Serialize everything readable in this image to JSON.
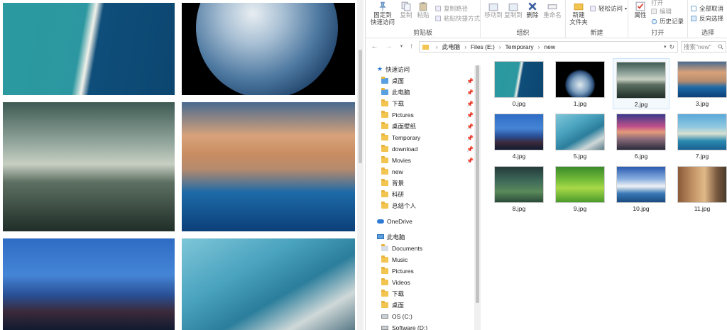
{
  "ribbon": {
    "pin_label": "固定到\n快速访问",
    "copy_label": "复制",
    "paste_label": "粘贴",
    "copy_path_label": "复制路径",
    "paste_shortcut_label": "粘贴快捷方式",
    "clipboard_group": "剪贴板",
    "move_to_label": "移动到",
    "copy_to_label": "复制到",
    "delete_label": "删除",
    "rename_label": "重命名",
    "organize_group": "组织",
    "new_folder_label": "新建\n文件夹",
    "easy_access_label": "轻松访问",
    "new_group": "新建",
    "properties_label": "属性",
    "open_label": "打开",
    "edit_label": "编辑",
    "history_label": "历史记录",
    "open_group": "打开",
    "select_all_label": "全部取消",
    "invert_label": "反向选择",
    "select_group": "选择"
  },
  "address": {
    "crumbs": [
      "此电脑",
      "Files (E:)",
      "Temporary",
      "new"
    ],
    "search_placeholder": "搜索\"new\""
  },
  "nav": {
    "quick_access": "快速访问",
    "items": [
      "桌面",
      "此电脑",
      "下载",
      "Pictures",
      "桌面壁纸",
      "Temporary",
      "download",
      "Movies",
      "new",
      "背景",
      "科研",
      "总结个人"
    ],
    "onedrive": "OneDrive",
    "this_pc": "此电脑",
    "pc_items": [
      "Documents",
      "Music",
      "Pictures",
      "Videos",
      "下载",
      "桌面",
      "OS (C:)",
      "Software (D:)"
    ]
  },
  "files": [
    "0.jpg",
    "1.jpg",
    "2.jpg",
    "3.jpg",
    "4.jpg",
    "5.jpg",
    "6.jpg",
    "7.jpg",
    "8.jpg",
    "9.jpg",
    "10.jpg",
    "11.jpg"
  ],
  "selected_file": "2.jpg",
  "colors": {
    "accent": "#0078d7",
    "folder": "#f2c450",
    "selection_border": "#cde4f7"
  }
}
